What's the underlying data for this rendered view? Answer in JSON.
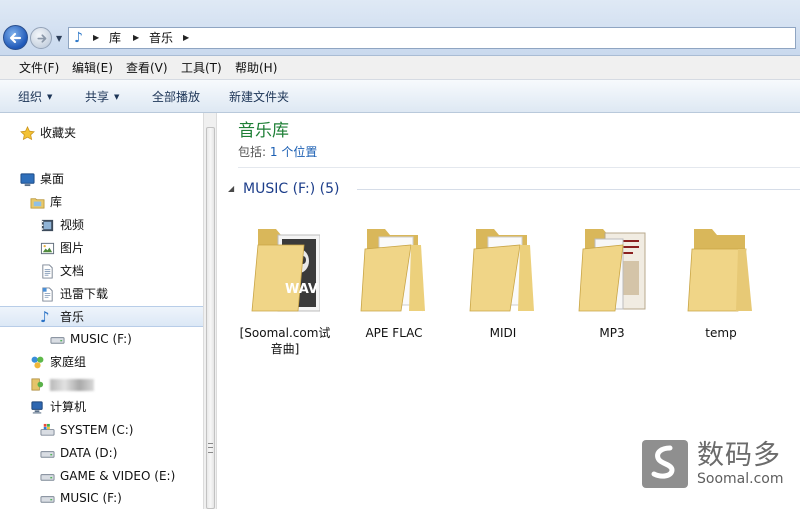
{
  "address": {
    "crumbs": [
      "库",
      "音乐"
    ],
    "location_icon": "music-note-icon"
  },
  "menu": [
    "文件(F)",
    "编辑(E)",
    "查看(V)",
    "工具(T)",
    "帮助(H)"
  ],
  "toolbar": {
    "organize": "组织",
    "share": "共享",
    "play_all": "全部播放",
    "new_folder": "新建文件夹"
  },
  "nav": {
    "favorites": "收藏夹",
    "desktop": "桌面",
    "libraries": "库",
    "videos": "视频",
    "pictures": "图片",
    "documents": "文档",
    "thunder": "迅雷下载",
    "music": "音乐",
    "music_drive": "MUSIC (F:)",
    "homegroup": "家庭组",
    "computer": "计算机",
    "drives": [
      "SYSTEM (C:)",
      "DATA (D:)",
      "GAME & VIDEO (E:)",
      "MUSIC (F:)"
    ]
  },
  "content": {
    "title": "音乐库",
    "includes_label": "包括:",
    "includes_link": "1 个位置",
    "group_title": "MUSIC (F:) (5)",
    "folders": [
      {
        "line1": "[Soomal.com试",
        "line2": "音曲]",
        "badge": "WAV"
      },
      {
        "line1": "APE FLAC",
        "line2": ""
      },
      {
        "line1": "MIDI",
        "line2": ""
      },
      {
        "line1": "MP3",
        "line2": ""
      },
      {
        "line1": "temp",
        "line2": ""
      }
    ]
  },
  "watermark": {
    "name": "数码多",
    "site": "Soomal.com"
  }
}
